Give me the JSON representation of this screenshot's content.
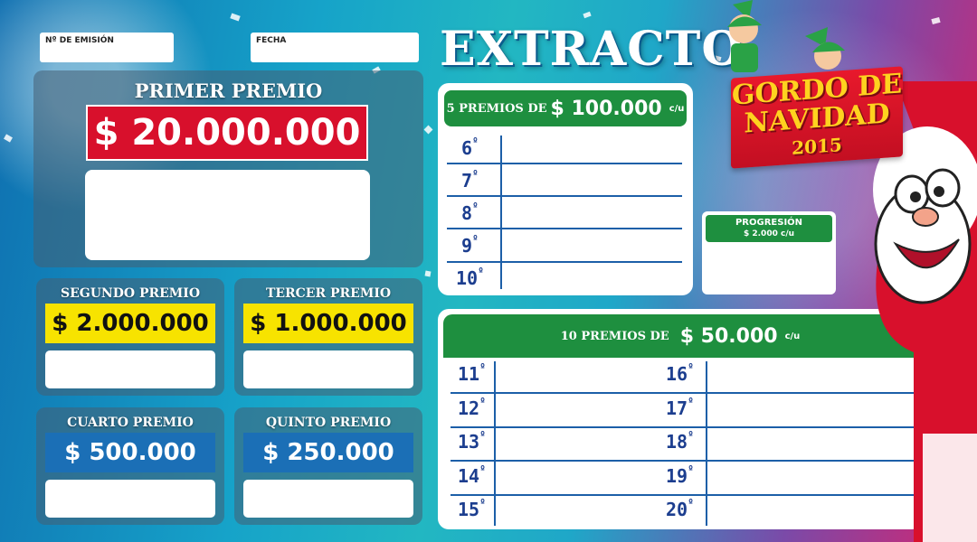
{
  "header": {
    "emision_label": "Nº DE EMISIÓN",
    "fecha_label": "FECHA",
    "title": "EXTRACTO"
  },
  "brand": {
    "line1": "GORDO DE",
    "line2": "NAVIDAD",
    "year": "2015"
  },
  "prizes": {
    "primer": {
      "title": "PRIMER PREMIO",
      "amount": "$ 20.000.000"
    },
    "segundo": {
      "title": "SEGUNDO PREMIO",
      "amount": "$ 2.000.000"
    },
    "tercer": {
      "title": "TERCER PREMIO",
      "amount": "$ 1.000.000"
    },
    "cuarto": {
      "title": "CUARTO PREMIO",
      "amount": "$ 500.000"
    },
    "quinto": {
      "title": "QUINTO PREMIO",
      "amount": "$ 250.000"
    }
  },
  "card5": {
    "prefix": "5 PREMIOS DE",
    "amount": "$ 100.000",
    "suffix": "c/u",
    "rows": [
      "6",
      "7",
      "8",
      "9",
      "10"
    ]
  },
  "progresion": {
    "title": "PROGRESIÓN",
    "subtitle": "$ 2.000 c/u"
  },
  "card10": {
    "prefix": "10 PREMIOS DE",
    "amount": "$ 50.000",
    "suffix": "c/u",
    "left_rows": [
      "11",
      "12",
      "13",
      "14",
      "15"
    ],
    "right_rows": [
      "16",
      "17",
      "18",
      "19",
      "20"
    ]
  },
  "ordinal_mark": "º",
  "colors": {
    "green": "#1e8f3f",
    "red": "#d8102c",
    "yellow": "#f7e300",
    "blue": "#1b6fb6",
    "line_blue": "#1c5fa8"
  }
}
